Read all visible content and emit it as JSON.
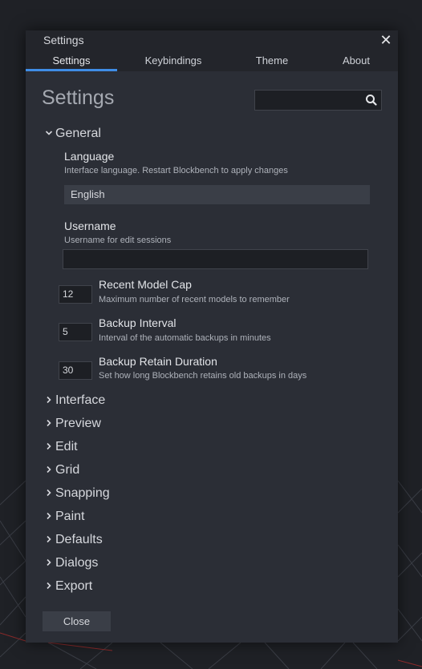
{
  "dialog": {
    "title": "Settings",
    "close_icon": "close-icon"
  },
  "tabs": [
    {
      "label": "Settings",
      "active": true
    },
    {
      "label": "Keybindings",
      "active": false
    },
    {
      "label": "Theme",
      "active": false
    },
    {
      "label": "About",
      "active": false
    }
  ],
  "page": {
    "heading": "Settings",
    "search": {
      "value": "",
      "placeholder": "",
      "icon": "search-icon"
    }
  },
  "general": {
    "label": "General",
    "expanded": true,
    "language": {
      "title": "Language",
      "description": "Interface language. Restart Blockbench to apply changes",
      "value": "English"
    },
    "username": {
      "title": "Username",
      "description": "Username for edit sessions",
      "value": ""
    },
    "recent_model_cap": {
      "title": "Recent Model Cap",
      "description": "Maximum number of recent models to remember",
      "value": "12"
    },
    "backup_interval": {
      "title": "Backup Interval",
      "description": "Interval of the automatic backups in minutes",
      "value": "5"
    },
    "backup_retain_duration": {
      "title": "Backup Retain Duration",
      "description": "Set how long Blockbench retains old backups in days",
      "value": "30"
    }
  },
  "sections": [
    {
      "label": "Interface"
    },
    {
      "label": "Preview"
    },
    {
      "label": "Edit"
    },
    {
      "label": "Grid"
    },
    {
      "label": "Snapping"
    },
    {
      "label": "Paint"
    },
    {
      "label": "Defaults"
    },
    {
      "label": "Dialogs"
    },
    {
      "label": "Export"
    }
  ],
  "footer": {
    "close_label": "Close"
  },
  "colors": {
    "background": "#1f2126",
    "dialog": "#2b2e36",
    "titlebar": "#23252b",
    "accent": "#3f8de6",
    "grid_line": "#3a3d45",
    "axis_red": "#8a2a2a"
  }
}
